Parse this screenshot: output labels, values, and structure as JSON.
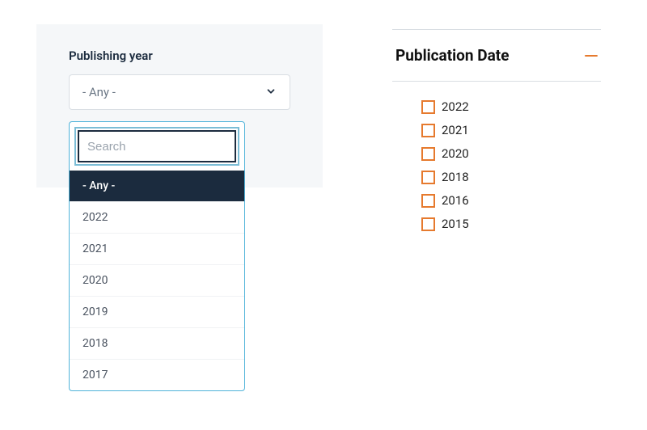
{
  "left": {
    "label": "Publishing year",
    "selected": "- Any -",
    "search_placeholder": "Search",
    "options": [
      "- Any -",
      "2022",
      "2021",
      "2020",
      "2019",
      "2018",
      "2017"
    ],
    "highlighted_index": 0
  },
  "right": {
    "title": "Publication Date",
    "items": [
      "2022",
      "2021",
      "2020",
      "2018",
      "2016",
      "2015"
    ]
  }
}
